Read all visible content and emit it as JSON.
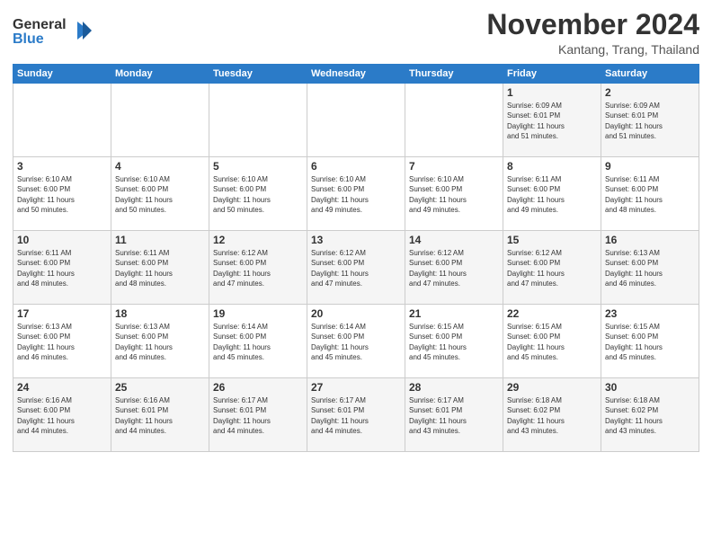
{
  "logo": {
    "line1": "General",
    "line2": "Blue"
  },
  "header": {
    "month": "November 2024",
    "location": "Kantang, Trang, Thailand"
  },
  "weekdays": [
    "Sunday",
    "Monday",
    "Tuesday",
    "Wednesday",
    "Thursday",
    "Friday",
    "Saturday"
  ],
  "weeks": [
    [
      {
        "day": "",
        "info": ""
      },
      {
        "day": "",
        "info": ""
      },
      {
        "day": "",
        "info": ""
      },
      {
        "day": "",
        "info": ""
      },
      {
        "day": "",
        "info": ""
      },
      {
        "day": "1",
        "info": "Sunrise: 6:09 AM\nSunset: 6:01 PM\nDaylight: 11 hours\nand 51 minutes."
      },
      {
        "day": "2",
        "info": "Sunrise: 6:09 AM\nSunset: 6:01 PM\nDaylight: 11 hours\nand 51 minutes."
      }
    ],
    [
      {
        "day": "3",
        "info": "Sunrise: 6:10 AM\nSunset: 6:00 PM\nDaylight: 11 hours\nand 50 minutes."
      },
      {
        "day": "4",
        "info": "Sunrise: 6:10 AM\nSunset: 6:00 PM\nDaylight: 11 hours\nand 50 minutes."
      },
      {
        "day": "5",
        "info": "Sunrise: 6:10 AM\nSunset: 6:00 PM\nDaylight: 11 hours\nand 50 minutes."
      },
      {
        "day": "6",
        "info": "Sunrise: 6:10 AM\nSunset: 6:00 PM\nDaylight: 11 hours\nand 49 minutes."
      },
      {
        "day": "7",
        "info": "Sunrise: 6:10 AM\nSunset: 6:00 PM\nDaylight: 11 hours\nand 49 minutes."
      },
      {
        "day": "8",
        "info": "Sunrise: 6:11 AM\nSunset: 6:00 PM\nDaylight: 11 hours\nand 49 minutes."
      },
      {
        "day": "9",
        "info": "Sunrise: 6:11 AM\nSunset: 6:00 PM\nDaylight: 11 hours\nand 48 minutes."
      }
    ],
    [
      {
        "day": "10",
        "info": "Sunrise: 6:11 AM\nSunset: 6:00 PM\nDaylight: 11 hours\nand 48 minutes."
      },
      {
        "day": "11",
        "info": "Sunrise: 6:11 AM\nSunset: 6:00 PM\nDaylight: 11 hours\nand 48 minutes."
      },
      {
        "day": "12",
        "info": "Sunrise: 6:12 AM\nSunset: 6:00 PM\nDaylight: 11 hours\nand 47 minutes."
      },
      {
        "day": "13",
        "info": "Sunrise: 6:12 AM\nSunset: 6:00 PM\nDaylight: 11 hours\nand 47 minutes."
      },
      {
        "day": "14",
        "info": "Sunrise: 6:12 AM\nSunset: 6:00 PM\nDaylight: 11 hours\nand 47 minutes."
      },
      {
        "day": "15",
        "info": "Sunrise: 6:12 AM\nSunset: 6:00 PM\nDaylight: 11 hours\nand 47 minutes."
      },
      {
        "day": "16",
        "info": "Sunrise: 6:13 AM\nSunset: 6:00 PM\nDaylight: 11 hours\nand 46 minutes."
      }
    ],
    [
      {
        "day": "17",
        "info": "Sunrise: 6:13 AM\nSunset: 6:00 PM\nDaylight: 11 hours\nand 46 minutes."
      },
      {
        "day": "18",
        "info": "Sunrise: 6:13 AM\nSunset: 6:00 PM\nDaylight: 11 hours\nand 46 minutes."
      },
      {
        "day": "19",
        "info": "Sunrise: 6:14 AM\nSunset: 6:00 PM\nDaylight: 11 hours\nand 45 minutes."
      },
      {
        "day": "20",
        "info": "Sunrise: 6:14 AM\nSunset: 6:00 PM\nDaylight: 11 hours\nand 45 minutes."
      },
      {
        "day": "21",
        "info": "Sunrise: 6:15 AM\nSunset: 6:00 PM\nDaylight: 11 hours\nand 45 minutes."
      },
      {
        "day": "22",
        "info": "Sunrise: 6:15 AM\nSunset: 6:00 PM\nDaylight: 11 hours\nand 45 minutes."
      },
      {
        "day": "23",
        "info": "Sunrise: 6:15 AM\nSunset: 6:00 PM\nDaylight: 11 hours\nand 45 minutes."
      }
    ],
    [
      {
        "day": "24",
        "info": "Sunrise: 6:16 AM\nSunset: 6:00 PM\nDaylight: 11 hours\nand 44 minutes."
      },
      {
        "day": "25",
        "info": "Sunrise: 6:16 AM\nSunset: 6:01 PM\nDaylight: 11 hours\nand 44 minutes."
      },
      {
        "day": "26",
        "info": "Sunrise: 6:17 AM\nSunset: 6:01 PM\nDaylight: 11 hours\nand 44 minutes."
      },
      {
        "day": "27",
        "info": "Sunrise: 6:17 AM\nSunset: 6:01 PM\nDaylight: 11 hours\nand 44 minutes."
      },
      {
        "day": "28",
        "info": "Sunrise: 6:17 AM\nSunset: 6:01 PM\nDaylight: 11 hours\nand 43 minutes."
      },
      {
        "day": "29",
        "info": "Sunrise: 6:18 AM\nSunset: 6:02 PM\nDaylight: 11 hours\nand 43 minutes."
      },
      {
        "day": "30",
        "info": "Sunrise: 6:18 AM\nSunset: 6:02 PM\nDaylight: 11 hours\nand 43 minutes."
      }
    ]
  ]
}
